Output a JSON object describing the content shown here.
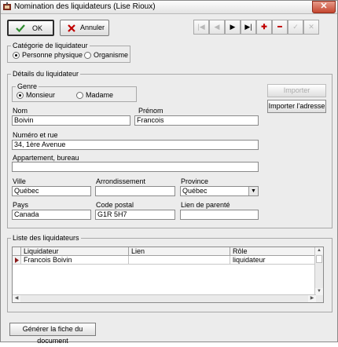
{
  "window": {
    "title": "Nomination des liquidateurs (Lise Rioux)",
    "close_glyph": "✕"
  },
  "toolbar": {
    "ok_label": "OK",
    "cancel_label": "Annuler",
    "nav": [
      {
        "name": "first-record",
        "glyph": "|◀",
        "enabled": false
      },
      {
        "name": "previous-record",
        "glyph": "◀",
        "enabled": false
      },
      {
        "name": "next-record",
        "glyph": "▶",
        "enabled": true
      },
      {
        "name": "last-record",
        "glyph": "▶|",
        "enabled": true
      },
      {
        "name": "add-record",
        "glyph": "✚",
        "enabled": true
      },
      {
        "name": "remove-record",
        "glyph": "━",
        "enabled": true
      },
      {
        "name": "confirm-record",
        "glyph": "✓",
        "enabled": false
      },
      {
        "name": "discard-record",
        "glyph": "✕",
        "enabled": false
      }
    ]
  },
  "category": {
    "legend": "Catégorie de liquidateur",
    "options": [
      "Personne physique",
      "Organisme"
    ],
    "selected": "Personne physique"
  },
  "details": {
    "legend": "Détails du liquidateur",
    "genre": {
      "legend": "Genre",
      "options": [
        "Monsieur",
        "Madame"
      ],
      "selected": "Monsieur"
    },
    "import_button": "Importer",
    "import_address_button": "Importer l'adresse",
    "nom": {
      "label": "Nom",
      "value": "Boivin"
    },
    "prenom": {
      "label": "Prénom",
      "value": "Francois"
    },
    "numero_rue": {
      "label": "Numéro et rue",
      "value": "34, 1ère Avenue"
    },
    "appartement": {
      "label": "Appartement, bureau",
      "value": ""
    },
    "ville": {
      "label": "Ville",
      "value": "Québec"
    },
    "arrondissement": {
      "label": "Arrondissement",
      "value": ""
    },
    "province": {
      "label": "Province",
      "value": "Québec"
    },
    "pays": {
      "label": "Pays",
      "value": "Canada"
    },
    "code_postal": {
      "label": "Code postal",
      "value": "G1R 5H7"
    },
    "lien_parente": {
      "label": "Lien de parenté",
      "value": ""
    }
  },
  "list": {
    "legend": "Liste des liquidateurs",
    "columns": [
      "Liquidateur",
      "Lien",
      "Rôle"
    ],
    "rows": [
      {
        "liquidateur": "Francois Boivin",
        "lien": "",
        "role": "liquidateur"
      }
    ]
  },
  "generate_button": "Générer la fiche du document",
  "colors": {
    "accent_red": "#c00000",
    "ok_check": "#2e8b2e",
    "cancel_x": "#c00000"
  }
}
